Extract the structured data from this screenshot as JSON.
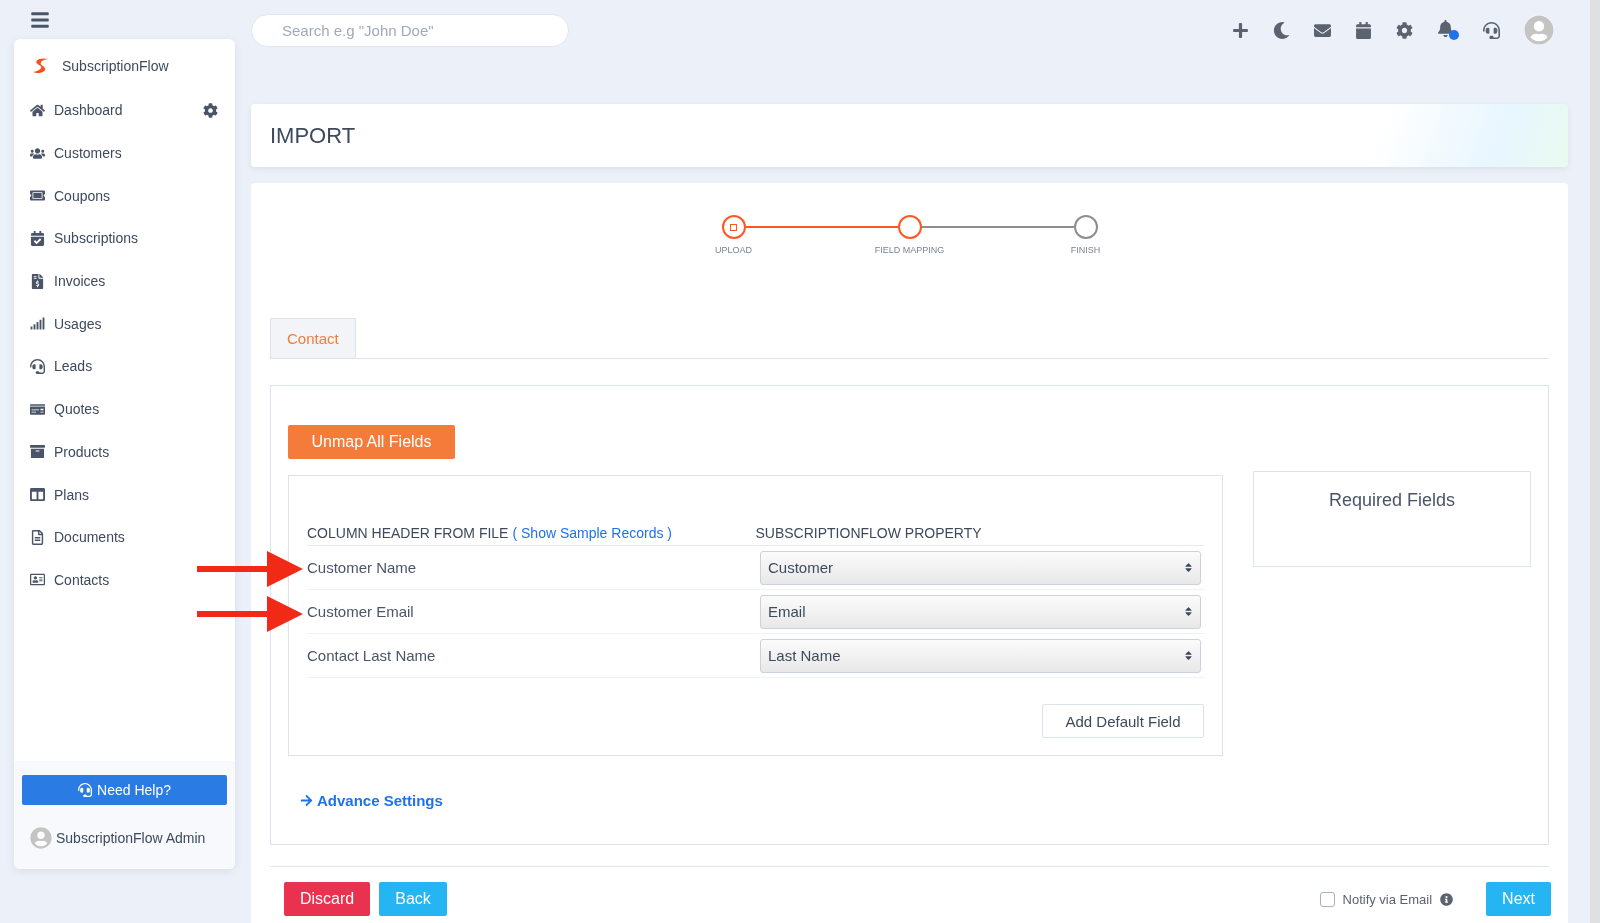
{
  "topbar": {
    "search": {
      "placeholder": "Search e.g \"John Doe\""
    }
  },
  "sidebar": {
    "brand": "SubscriptionFlow",
    "items": [
      {
        "label": "Dashboard"
      },
      {
        "label": "Customers"
      },
      {
        "label": "Coupons"
      },
      {
        "label": "Subscriptions"
      },
      {
        "label": "Invoices"
      },
      {
        "label": "Usages"
      },
      {
        "label": "Leads"
      },
      {
        "label": "Quotes"
      },
      {
        "label": "Products"
      },
      {
        "label": "Plans"
      },
      {
        "label": "Documents"
      },
      {
        "label": "Contacts"
      }
    ],
    "help_button": "Need Help?",
    "user": "SubscriptionFlow Admin"
  },
  "page_title": "IMPORT",
  "steps": [
    {
      "label": "UPLOAD",
      "reached": true,
      "done": true
    },
    {
      "label": "FIELD MAPPING",
      "reached": true,
      "done": false
    },
    {
      "label": "FINISH",
      "reached": false,
      "done": false
    }
  ],
  "tabs": [
    {
      "label": "Contact",
      "selected": true
    }
  ],
  "unmap_button": "Unmap All Fields",
  "mapping": {
    "column_header": "COLUMN HEADER FROM FILE",
    "sample_link": "( Show Sample Records )",
    "property_header": "SUBSCRIPTIONFLOW PROPERTY",
    "rows": [
      {
        "source": "Customer Name",
        "value": "Customer",
        "marked": true
      },
      {
        "source": "Customer Email",
        "value": "Email",
        "marked": true
      },
      {
        "source": "Contact Last Name",
        "value": "Last Name",
        "marked": false
      }
    ],
    "add_button": "Add Default Field"
  },
  "required_fields": {
    "title": "Required Fields"
  },
  "advance_settings": "Advance Settings",
  "footer": {
    "discard": "Discard",
    "back": "Back",
    "notify": {
      "label": "Notify via Email",
      "checked": false
    },
    "next": "Next"
  }
}
